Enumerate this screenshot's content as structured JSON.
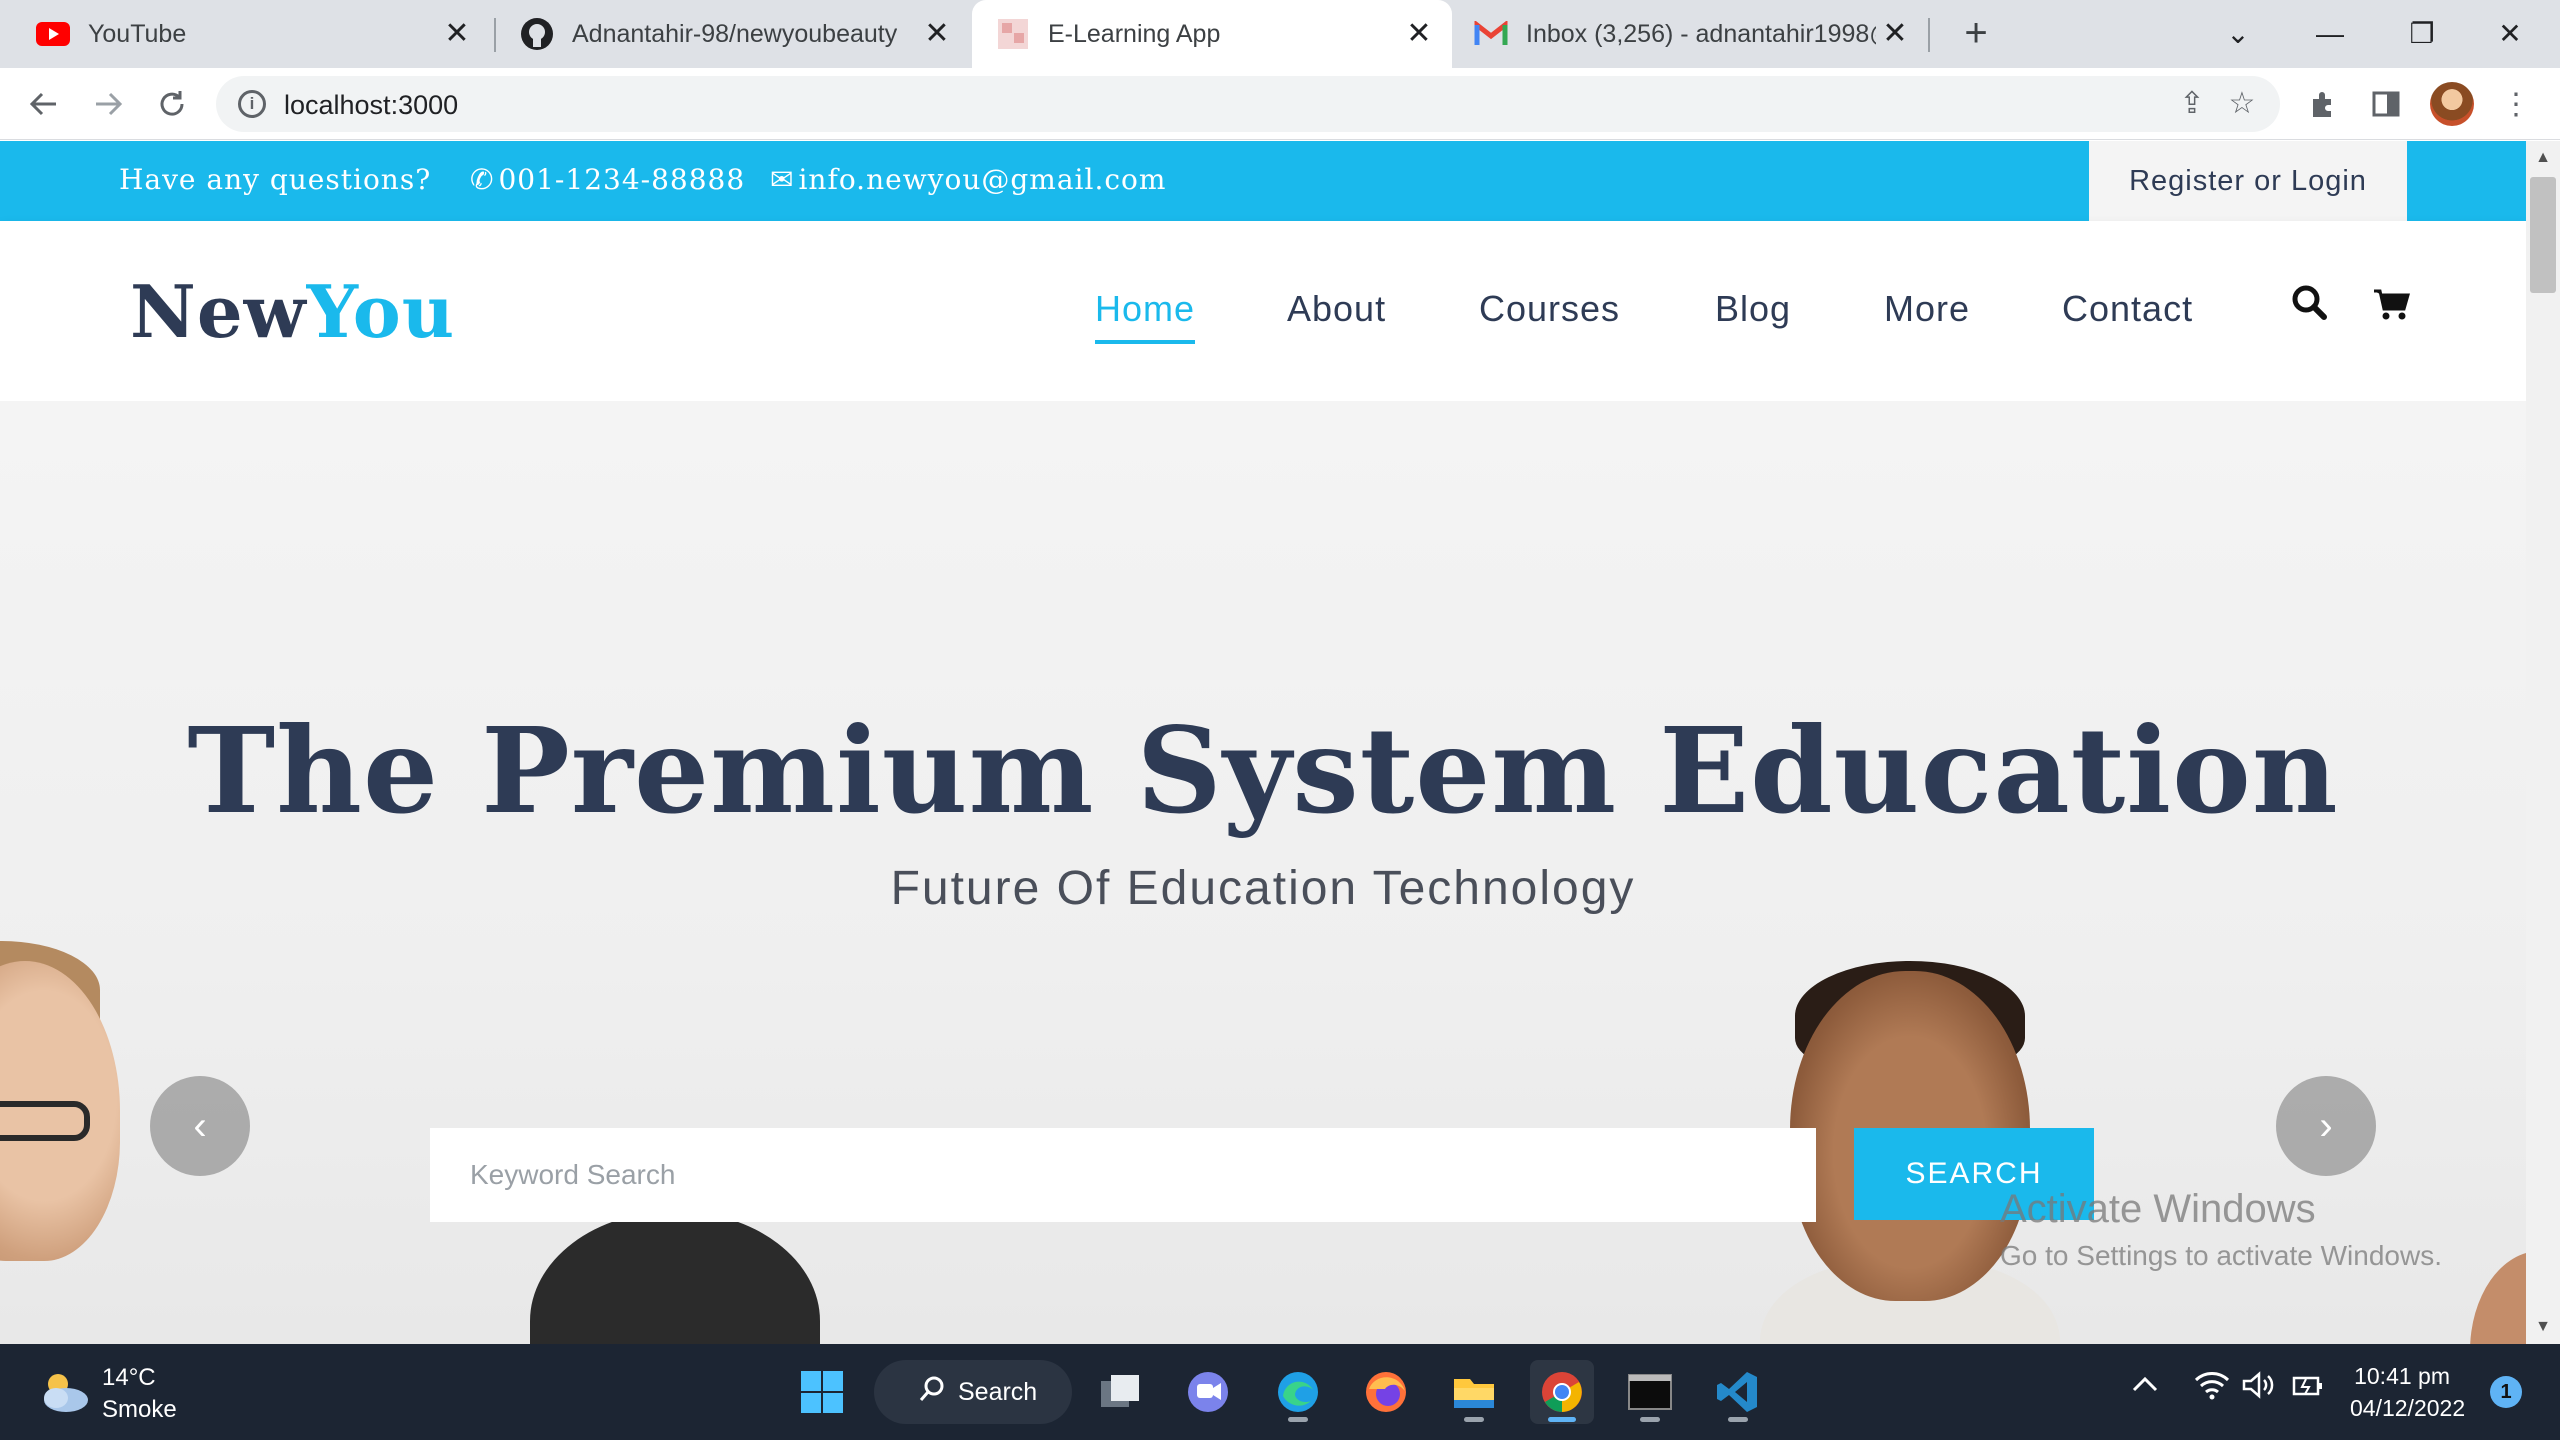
{
  "browser": {
    "tabs": [
      {
        "title": "YouTube",
        "favicon": "youtube-icon",
        "active": false
      },
      {
        "title": "Adnantahir-98/newyoubeauty",
        "favicon": "github-icon",
        "active": false
      },
      {
        "title": "E-Learning App",
        "favicon": "page-icon",
        "active": true
      },
      {
        "title": "Inbox (3,256) - adnantahir1998@",
        "favicon": "gmail-icon",
        "active": false
      }
    ],
    "url": "localhost:3000"
  },
  "topbar": {
    "question": "Have any questions?",
    "phone": "001-1234-88888",
    "email": "info.newyou@gmail.com",
    "login_label": "Register or Login"
  },
  "logo": {
    "part1": "New",
    "part2": "You"
  },
  "nav": {
    "items": [
      "Home",
      "About",
      "Courses",
      "Blog",
      "More",
      "Contact"
    ],
    "active": "Home"
  },
  "hero": {
    "title": "The Premium System Education",
    "subtitle": "Future Of Education Technology",
    "search_placeholder": "Keyword Search",
    "search_button": "SEARCH"
  },
  "watermark": {
    "line1": "Activate Windows",
    "line2": "Go to Settings to activate Windows."
  },
  "taskbar": {
    "weather_temp": "14°C",
    "weather_desc": "Smoke",
    "search_label": "Search",
    "time": "10:41 pm",
    "date": "04/12/2022",
    "notifications": "1"
  },
  "colors": {
    "accent": "#1ab9ec",
    "heading": "#2e3b55",
    "taskbar": "#1c2533"
  }
}
